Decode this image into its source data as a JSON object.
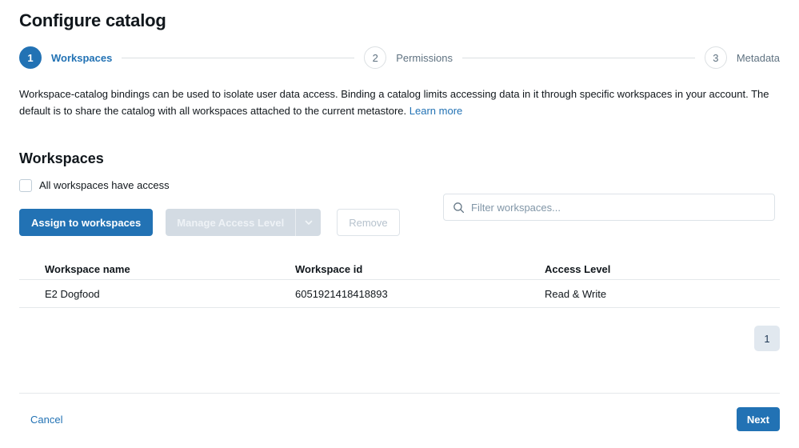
{
  "header": {
    "title": "Configure catalog"
  },
  "stepper": {
    "steps": [
      {
        "number": "1",
        "label": "Workspaces",
        "state": "active"
      },
      {
        "number": "2",
        "label": "Permissions",
        "state": "inactive"
      },
      {
        "number": "3",
        "label": "Metadata",
        "state": "inactive"
      }
    ]
  },
  "description": {
    "text": "Workspace-catalog bindings can be used to isolate user data access. Binding a catalog limits accessing data in it through specific workspaces in your account. The default is to share the catalog with all workspaces attached to the current metastore.",
    "link_label": "Learn more"
  },
  "workspaces_section": {
    "title": "Workspaces",
    "checkbox": {
      "label": "All workspaces have access",
      "checked": false
    },
    "toolbar": {
      "assign_label": "Assign to workspaces",
      "manage_access_label": "Manage Access Level",
      "manage_access_caret_icon": "chevron-down-icon",
      "remove_label": "Remove"
    },
    "search": {
      "placeholder": "Filter workspaces...",
      "value": "",
      "icon": "search-icon"
    },
    "table": {
      "columns": [
        "Workspace name",
        "Workspace id",
        "Access Level"
      ],
      "rows": [
        {
          "name": "E2 Dogfood",
          "id": "6051921418418893",
          "access_level": "Read & Write"
        }
      ]
    },
    "pagination": {
      "current_page": "1"
    }
  },
  "footer": {
    "cancel_label": "Cancel",
    "next_label": "Next"
  },
  "colors": {
    "accent": "#2272b4",
    "text": "#11171c",
    "muted": "#5f7281",
    "border": "#e4e8eb",
    "disabled_fill": "#d3dbe3",
    "pagination_fill": "#e1e8ef"
  }
}
